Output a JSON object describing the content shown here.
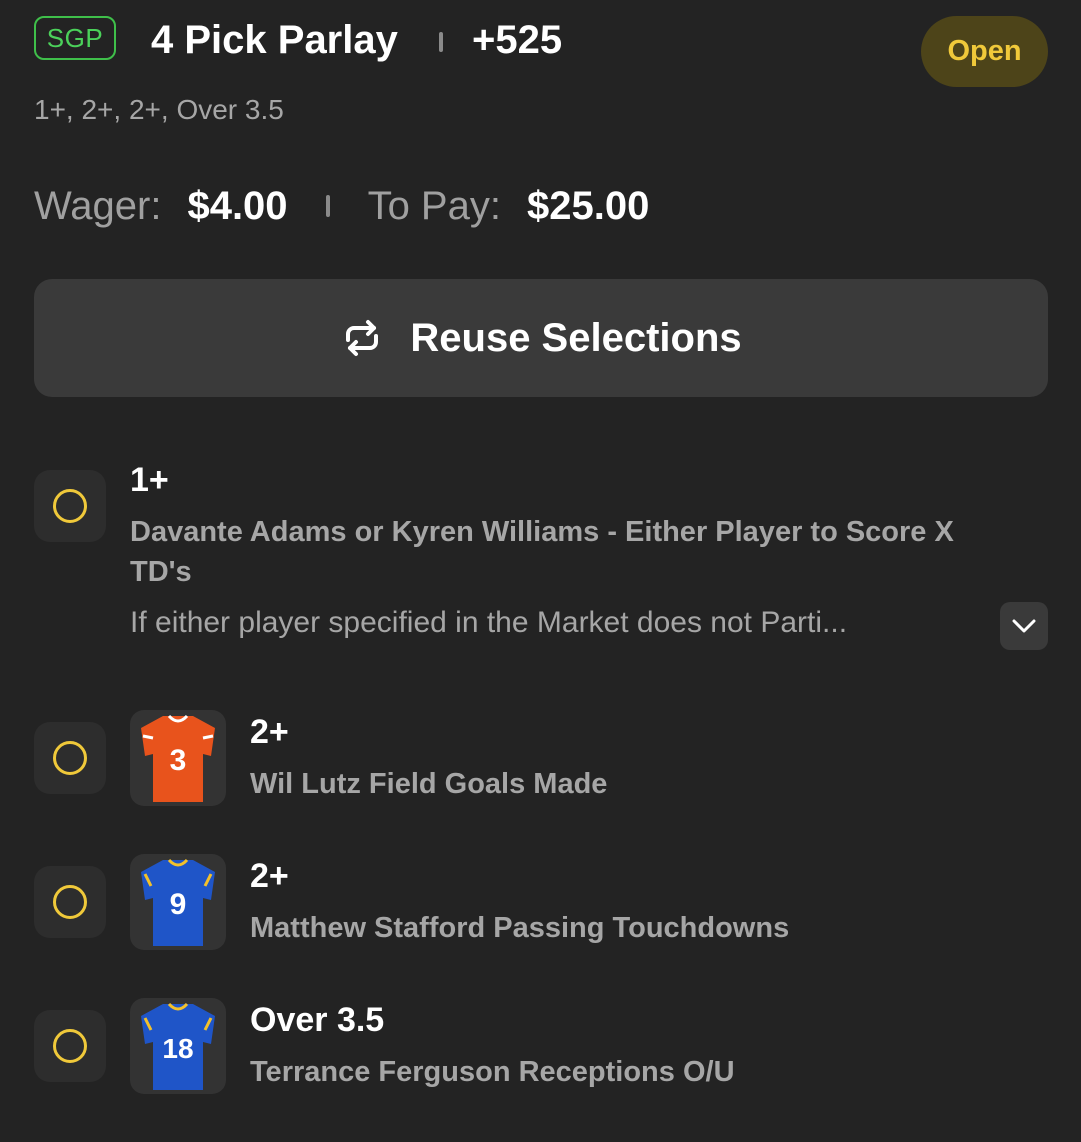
{
  "header": {
    "badge": "SGP",
    "title": "4 Pick Parlay",
    "odds": "+525",
    "status": "Open",
    "summary": "1+, 2+, 2+, Over 3.5"
  },
  "wager": {
    "wager_label": "Wager:",
    "wager_value": "$4.00",
    "pay_label": "To Pay:",
    "pay_value": "$25.00"
  },
  "reuse": {
    "label": "Reuse Selections",
    "icon": "repeat-icon"
  },
  "legs": [
    {
      "pick": "1+",
      "market": "Davante Adams or Kyren Williams - Either Player to Score X TD's",
      "note": "If either player specified in the Market does not Parti...",
      "status": "open",
      "jersey": null
    },
    {
      "pick": "2+",
      "market": "Wil Lutz Field Goals Made",
      "status": "open",
      "jersey": {
        "number": "3",
        "color": "#e8531c",
        "trim": "#ffffff"
      }
    },
    {
      "pick": "2+",
      "market": "Matthew Stafford Passing Touchdowns",
      "status": "open",
      "jersey": {
        "number": "9",
        "color": "#1f55c8",
        "trim": "#f3c12b"
      }
    },
    {
      "pick": "Over 3.5",
      "market": "Terrance Ferguson Receptions O/U",
      "status": "open",
      "jersey": {
        "number": "18",
        "color": "#1f55c8",
        "trim": "#f3c12b"
      }
    }
  ],
  "colors": {
    "background": "#232323",
    "accent_green": "#4bd15a",
    "accent_yellow": "#f0c93a",
    "status_pill_bg": "#4d4419"
  }
}
